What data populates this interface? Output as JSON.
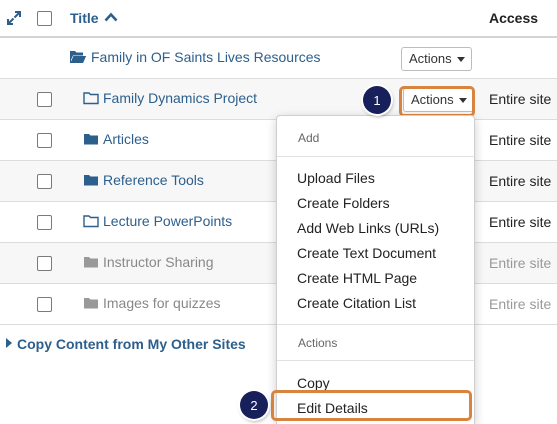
{
  "header": {
    "title": "Title",
    "access": "Access"
  },
  "rows": [
    {
      "name": "Family in OF Saints Lives Resources",
      "actions_label": "Actions",
      "access": ""
    },
    {
      "name": "Family Dynamics Project",
      "actions_label": "Actions",
      "access": "Entire site"
    },
    {
      "name": "Articles",
      "access": "Entire site"
    },
    {
      "name": "Reference Tools",
      "access": "Entire site"
    },
    {
      "name": "Lecture PowerPoints",
      "access": "Entire site"
    },
    {
      "name": "Instructor Sharing",
      "access": "Entire site"
    },
    {
      "name": "Images for quizzes",
      "access": "Entire site"
    }
  ],
  "copy_link": "Copy Content from My Other Sites",
  "dropdown": {
    "add_header": "Add",
    "add_items": [
      "Upload Files",
      "Create Folders",
      "Add Web Links (URLs)",
      "Create Text Document",
      "Create HTML Page",
      "Create Citation List"
    ],
    "actions_header": "Actions",
    "action_items": [
      "Copy",
      "Edit Details"
    ]
  },
  "badges": {
    "first": "1",
    "second": "2"
  },
  "colors": {
    "link": "#2c5f8c",
    "highlight": "#d9843e",
    "badge": "#17205a",
    "folder_blue": "#2c5f8c",
    "folder_gray": "#999999"
  },
  "icons": {
    "expand": "expand-arrows-icon",
    "sort": "caret-up-icon",
    "folder_open": "folder-open-icon",
    "folder_outline": "folder-outline-icon",
    "folder_solid": "folder-icon",
    "caret": "caret-down-icon",
    "collapsed": "caret-right-icon"
  }
}
